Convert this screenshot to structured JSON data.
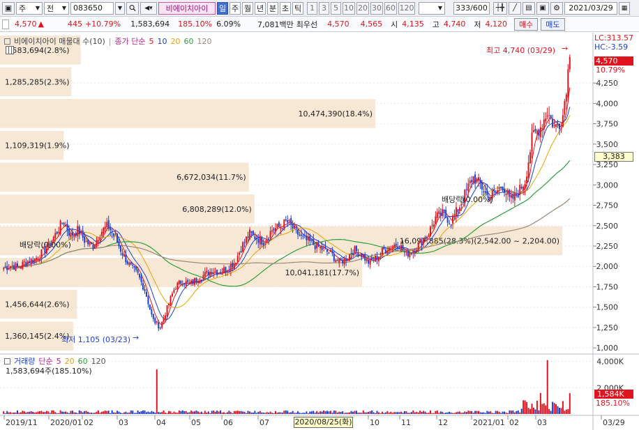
{
  "toolbar": {
    "market": "주",
    "type": "전",
    "code": "083650",
    "stock_name": "비에이치아이",
    "periods": [
      "일",
      "주",
      "월",
      "년",
      "분",
      "초",
      "틱"
    ],
    "selected_period": "일",
    "intervals": [
      "1",
      "3",
      "5",
      "10",
      "20",
      "30",
      "60",
      "120"
    ],
    "count": "333",
    "total": "/600",
    "date": "2021/03/29"
  },
  "quote": {
    "price": "4,570",
    "change": "445",
    "change_pct": "+10.79%",
    "volume": "1,583,694",
    "volume_ratio": "185.10%",
    "turnover": "6.09%",
    "amount": "7,081백만",
    "best_label": "최우선",
    "ask": "4,570",
    "bid": "4,565",
    "open_label": "시",
    "open": "4,135",
    "high_label": "고",
    "high": "4,740",
    "low_label": "저",
    "low": "4,120",
    "buy_label": "매수",
    "sell_label": "매도"
  },
  "price_legend": {
    "title": "비에이치아이 매물대 수(10)",
    "ma_label": "종가 단순",
    "periods": [
      "5",
      "10",
      "20",
      "60",
      "120"
    ],
    "colors": [
      "#e0141e",
      "#1b3fd0",
      "#e8a400",
      "#2e9f3a",
      "#9a8878"
    ]
  },
  "volume_legend": {
    "title": "거래량",
    "ma_label": "단순",
    "periods": [
      "5",
      "20",
      "60",
      "120"
    ],
    "colors": [
      "#c0208f",
      "#e8a400",
      "#2e9f3a",
      "#555555"
    ],
    "value": "1,583,694주(185.10%)"
  },
  "side_labels": {
    "lc": "LC:313.57",
    "hc": "HC:-3.59",
    "current_price": "4,570",
    "current_pct": "10.79%",
    "cursor_price": "3,383",
    "vol_current": "1,584K",
    "vol_pct": "185.10%"
  },
  "annotations": {
    "high": "최고 4,740 (03/29)",
    "low": "최저 1,105 (03/23)",
    "dividend_left": "배당락(0.00%)",
    "dividend_right": "배당락(0.00%)"
  },
  "chart_data": {
    "type": "candlestick",
    "price_axis": {
      "ticks": [
        "4,250",
        "4,000",
        "3,750",
        "3,500",
        "3,250",
        "3,000",
        "2,750",
        "2,500",
        "2,250",
        "2,000",
        "1,750",
        "1,500",
        "1,250",
        "1,000"
      ],
      "ylim": [
        950,
        4850
      ]
    },
    "volume_axis": {
      "ticks": [
        "4,000K",
        "2,000K"
      ],
      "ylim": [
        0,
        4300
      ]
    },
    "x_ticks": [
      "2019/11",
      "2020/01",
      "02",
      "03",
      "04",
      "05",
      "06",
      "07",
      "2020/08/25(화)",
      "10",
      "11",
      "12",
      "2021/01",
      "02",
      "03",
      "03/29"
    ],
    "volume_profile": [
      {
        "label": "1,583,694(2.8%)",
        "pct": 2.8
      },
      {
        "label": "1,285,285(2.3%)",
        "pct": 2.3
      },
      {
        "label": "10,474,390(18.4%)",
        "pct": 18.4
      },
      {
        "label": "1,109,319(1.9%)",
        "pct": 1.9
      },
      {
        "label": "6,672,034(11.7%)",
        "pct": 11.7
      },
      {
        "label": "6,808,289(12.0%)",
        "pct": 12.0
      },
      {
        "label": "16,097,885(28.3%)(2,542.00 ~ 2,204.00)",
        "pct": 28.3
      },
      {
        "label": "10,041,181(17.7%)",
        "pct": 17.7
      },
      {
        "label": "1,456,644(2.6%)",
        "pct": 2.6
      },
      {
        "label": "1,360,145(2.4%)",
        "pct": 2.4
      }
    ],
    "close_path": [
      1980,
      2010,
      1990,
      2060,
      2080,
      2150,
      2250,
      2400,
      2560,
      2380,
      2450,
      2300,
      2250,
      2420,
      2500,
      2350,
      2150,
      2000,
      1900,
      1700,
      1350,
      1250,
      1500,
      1750,
      1820,
      1780,
      1850,
      1900,
      1950,
      1930,
      1980,
      2050,
      2250,
      2400,
      2350,
      2300,
      2450,
      2480,
      2550,
      2450,
      2350,
      2300,
      2250,
      2200,
      2150,
      2050,
      2100,
      2200,
      2150,
      2050,
      2100,
      2200,
      2250,
      2280,
      2150,
      2200,
      2300,
      2400,
      2600,
      2650,
      2550,
      2700,
      2900,
      3100,
      3000,
      2850,
      2900,
      3000,
      2800,
      2900,
      3050,
      3600,
      3700,
      3900,
      3700,
      3800,
      4570
    ]
  }
}
